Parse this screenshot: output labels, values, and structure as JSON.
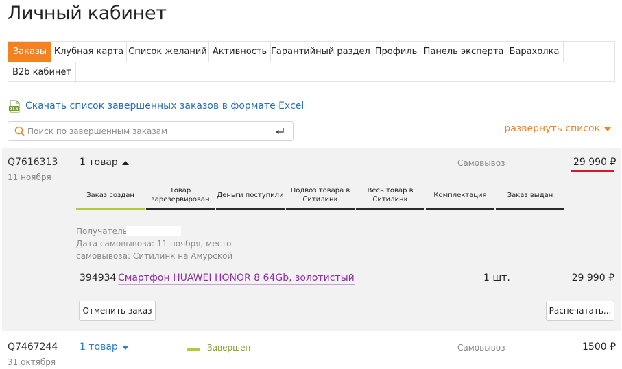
{
  "page": {
    "title": "Личный кабинет"
  },
  "tabs": [
    {
      "label": "Заказы",
      "active": true
    },
    {
      "label": "Клубная карта"
    },
    {
      "label": "Список желаний"
    },
    {
      "label": "Активность"
    },
    {
      "label": "Гарантийный раздел"
    },
    {
      "label": "Профиль"
    },
    {
      "label": "Панель эксперта"
    },
    {
      "label": "Барахолка"
    },
    {
      "label": "B2b кабинет"
    }
  ],
  "excel": {
    "icon": "xls-file-icon",
    "label": "Скачать список завершенных заказов в формате Excel"
  },
  "search": {
    "placeholder": "Поиск по завершенным заказам",
    "value": ""
  },
  "expand": {
    "label": "развернуть список"
  },
  "orders": [
    {
      "id": "Q7616313",
      "date": "11 ноября",
      "items_label": "1 товар",
      "delivery": "Самовывоз",
      "price": "29 990",
      "currency": "₽",
      "steps": [
        {
          "label": "Заказ создан",
          "done": true
        },
        {
          "label": "Товар зарезервирован",
          "done": false
        },
        {
          "label": "Деньги поступили",
          "done": false
        },
        {
          "label": "Подвоз товара в Ситилинк",
          "done": false
        },
        {
          "label": "Весь товар в Ситилинк",
          "done": false
        },
        {
          "label": "Комплектация",
          "done": false
        },
        {
          "label": "Заказ выдан",
          "done": false
        }
      ],
      "recipient_label": "Получатель:",
      "pickup_date_line": "Дата самовывоза: 11 ноября, место",
      "pickup_place_line": "самовывоза: Ситилинк на Амурской",
      "product": {
        "sku": "394934",
        "name": "Смартфон HUAWEI HONOR 8 64Gb, золотистый",
        "qty": "1 шт.",
        "price": "29 990",
        "currency": "₽"
      },
      "cancel_label": "Отменить заказ",
      "print_label": "Распечатать..."
    },
    {
      "id": "Q7467244",
      "date": "31 октября",
      "items_label": "1 товар",
      "status": "Завершен",
      "delivery": "Самовывоз",
      "price": "1500",
      "currency": "₽"
    }
  ],
  "colors": {
    "accent": "#f58220",
    "link": "#2a6fb5",
    "product_link": "#8e2fa0",
    "progress_done": "#b7c934",
    "price_underline": "#d41b2c"
  }
}
